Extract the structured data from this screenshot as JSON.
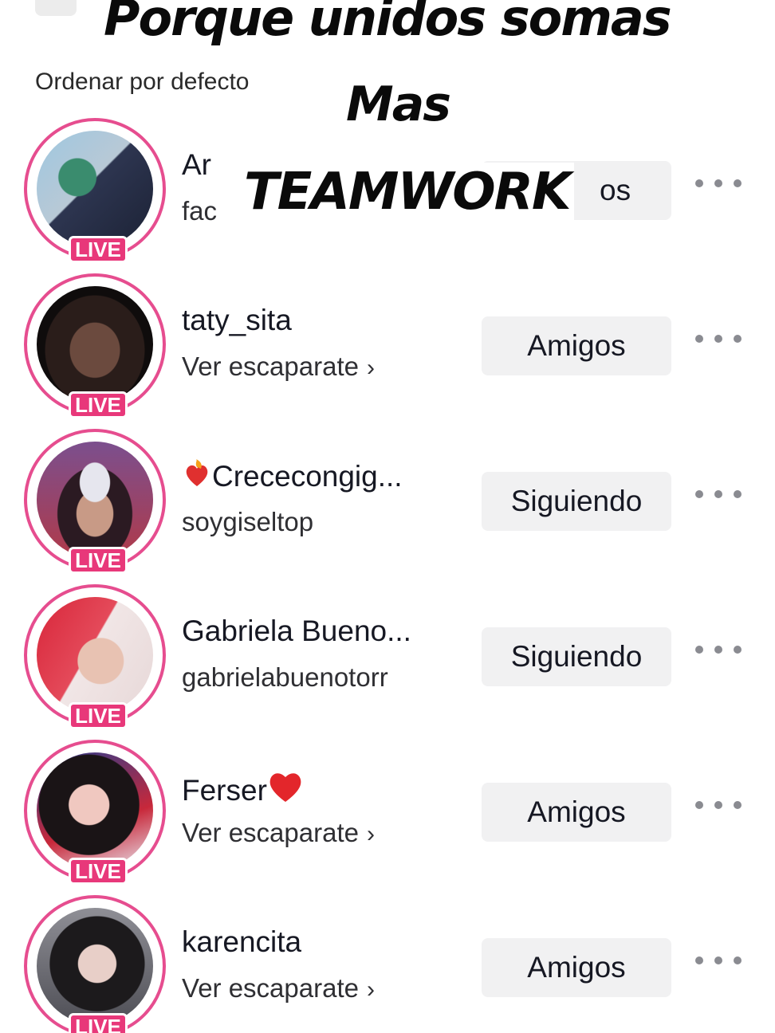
{
  "overlay": {
    "line1": "Porque unidos somas",
    "line2": "Mas",
    "line3": "TEAMWORK"
  },
  "sort_label": "Ordenar por defecto",
  "live_label": "LIVE",
  "more_icon": "more-horizontal-icon",
  "accent_color": "#e8387a",
  "rows": [
    {
      "name": "Ar",
      "sub": "fac",
      "sub_chevron": false,
      "button": "os"
    },
    {
      "name": "taty_sita",
      "sub": "Ver escaparate",
      "sub_chevron": true,
      "button": "Amigos"
    },
    {
      "name_prefix_icon": "fire-heart-emoji",
      "name": "Crececongig...",
      "sub": "soygiseltop",
      "sub_chevron": false,
      "button": "Siguiendo"
    },
    {
      "name": "Gabriela Bueno...",
      "sub": "gabrielabuenotorr",
      "sub_chevron": false,
      "button": "Siguiendo"
    },
    {
      "name": "Ferser",
      "name_suffix_icon": "red-heart-emoji",
      "sub": "Ver escaparate",
      "sub_chevron": true,
      "button": "Amigos"
    },
    {
      "name": "karencita",
      "sub": "Ver escaparate",
      "sub_chevron": true,
      "button": "Amigos"
    }
  ],
  "chevron_glyph": "›"
}
